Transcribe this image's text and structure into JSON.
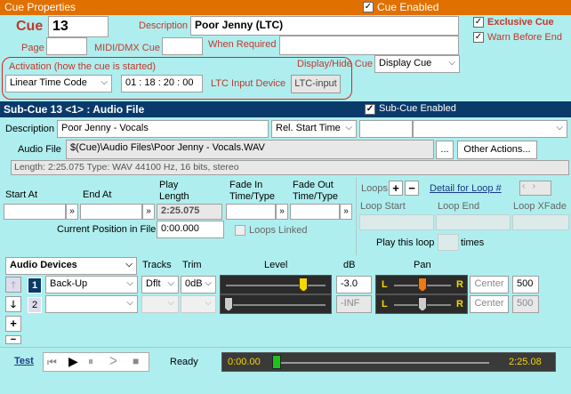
{
  "cue_properties": {
    "title": "Cue Properties",
    "cue_enabled_label": "Cue Enabled",
    "cue_enabled": true,
    "cue_label": "Cue",
    "cue_number": "13",
    "description_label": "Description",
    "description_value": "Poor Jenny (LTC)",
    "exclusive_cue_label": "Exclusive Cue",
    "warn_before_end_label": "Warn Before End",
    "page_label": "Page",
    "midi_dmx_label": "MIDI/DMX Cue",
    "when_required_label": "When Required",
    "activation_label": "Activation (how the cue is started)",
    "activation_value": "Linear Time Code",
    "time_code_value": "01 : 18 : 20 : 00",
    "ltc_input_label": "LTC Input Device",
    "ltc_input_button": "LTC-input",
    "display_hide_label": "Display/Hide Cue",
    "display_hide_value": "Display Cue"
  },
  "sub_cue": {
    "title": "Sub-Cue 13 <1> : Audio File",
    "enabled_label": "Sub-Cue Enabled",
    "description_label": "Description",
    "description_value": "Poor Jenny - Vocals",
    "rel_start_value": "Rel. Start Time",
    "audio_file_label": "Audio File",
    "audio_file_value": "$(Cue)\\Audio Files\\Poor Jenny - Vocals.WAV",
    "browse_label": "...",
    "other_actions_label": "Other Actions...",
    "file_info": "Length: 2:25.075  Type: WAV 44100 Hz, 16 bits, stereo"
  },
  "timing": {
    "start_at_label": "Start At",
    "end_at_label": "End At",
    "play_length_label": "Play\nLength",
    "play_length_value": "2:25.075",
    "fade_in_label": "Fade In\nTime/Type",
    "fade_out_label": "Fade Out\nTime/Type",
    "current_position_label": "Current Position in File",
    "current_position_value": "0:00.000",
    "loops_linked_label": "Loops Linked",
    "loops_label": "Loops",
    "detail_for_loop_label": "Detail for Loop #",
    "loop_start_label": "Loop Start",
    "loop_end_label": "Loop End",
    "loop_xfade_label": "Loop XFade",
    "play_this_loop_label": "Play this loop",
    "times_label": "times"
  },
  "audio_devices": {
    "header_label": "Audio Devices",
    "tracks_label": "Tracks",
    "trim_label": "Trim",
    "level_label": "Level",
    "db_label": "dB",
    "pan_label": "Pan",
    "rows": [
      {
        "num": "1",
        "device": "Back-Up",
        "tracks": "Dflt",
        "trim": "0dB",
        "db": "-3.0",
        "center": "Center",
        "pan_value": "500",
        "level_fraction": 0.78,
        "pan_fraction": 0.5
      },
      {
        "num": "2",
        "device": "",
        "tracks": "",
        "trim": "",
        "db": "-INF",
        "center": "Center",
        "pan_value": "500",
        "level_fraction": 0.0,
        "pan_fraction": 0.5
      }
    ]
  },
  "transport": {
    "test_label": "Test",
    "status": "Ready",
    "position": "0:00.00",
    "length": "2:25.08",
    "progress_fraction": 0.0
  },
  "colors": {
    "header_orange": "#e07000",
    "subcue_navy": "#0a3a6a",
    "background": "#afeeee",
    "highlight_red": "#e02020"
  }
}
